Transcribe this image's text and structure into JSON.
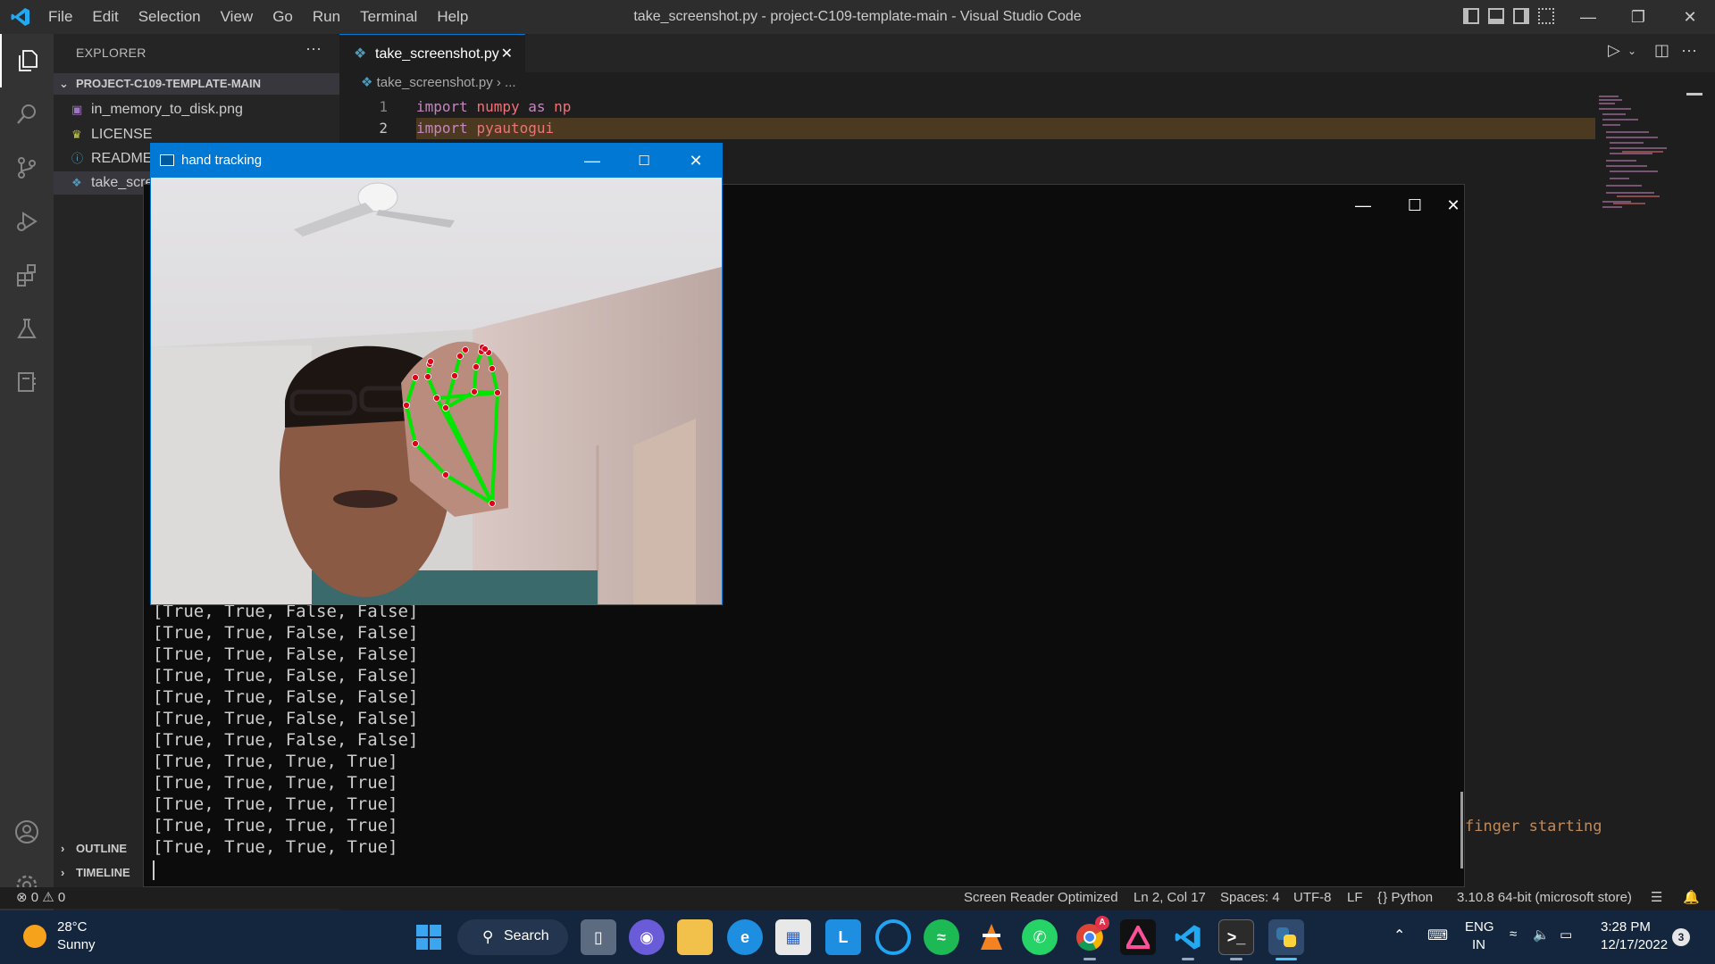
{
  "titlebar": {
    "menu": [
      "File",
      "Edit",
      "Selection",
      "View",
      "Go",
      "Run",
      "Terminal",
      "Help"
    ],
    "title": "take_screenshot.py - project-C109-template-main - Visual Studio Code"
  },
  "sidebar": {
    "header": "EXPLORER",
    "more": "···",
    "folder": "PROJECT-C109-TEMPLATE-MAIN",
    "files": [
      {
        "name": "in_memory_to_disk.png",
        "icon": "image-file-icon"
      },
      {
        "name": "LICENSE",
        "icon": "license-file-icon"
      },
      {
        "name": "README.",
        "icon": "info-file-icon"
      },
      {
        "name": "take_scre",
        "icon": "python-file-icon"
      }
    ],
    "outline": "OUTLINE",
    "timeline": "TIMELINE"
  },
  "editor": {
    "tab": "take_screenshot.py",
    "breadcrumb": "take_screenshot.py",
    "breadcrumb_more": "...",
    "lines": [
      {
        "num": "1",
        "kw": "import",
        "mod": "numpy",
        "as": "as",
        "alias": "np"
      },
      {
        "num": "2",
        "kw": "import",
        "mod": "pyautogui"
      }
    ],
    "peek_text": "finger starting"
  },
  "console": {
    "lines": [
      "[True, True, False, False]",
      "[True, True, False, False]",
      "[True, True, False, False]",
      "[True, True, False, False]",
      "[True, True, False, False]",
      "[True, True, False, False]",
      "[True, True, False, False]",
      "[True, True, True, True]",
      "[True, True, True, True]",
      "[True, True, True, True]",
      "[True, True, True, True]",
      "[True, True, True, True]"
    ]
  },
  "hand_window": {
    "title": "hand tracking"
  },
  "statusbar": {
    "errors": "0",
    "warnings": "0",
    "screen_reader": "Screen Reader Optimized",
    "position": "Ln 2, Col 17",
    "spaces": "Spaces: 4",
    "encoding": "UTF-8",
    "eol": "LF",
    "language": "Python",
    "interpreter": "3.10.8 64-bit (microsoft store)"
  },
  "taskbar": {
    "weather_temp": "28°C",
    "weather_desc": "Sunny",
    "search": "Search",
    "lang_top": "ENG",
    "lang_bottom": "IN",
    "time": "3:28 PM",
    "date": "12/17/2022",
    "notifications": "3",
    "chrome_badge": "A",
    "l_app": "L"
  },
  "colors": {
    "accent": "#0078d4",
    "landmark_line": "#00e600",
    "landmark_point": "#e0001b"
  }
}
